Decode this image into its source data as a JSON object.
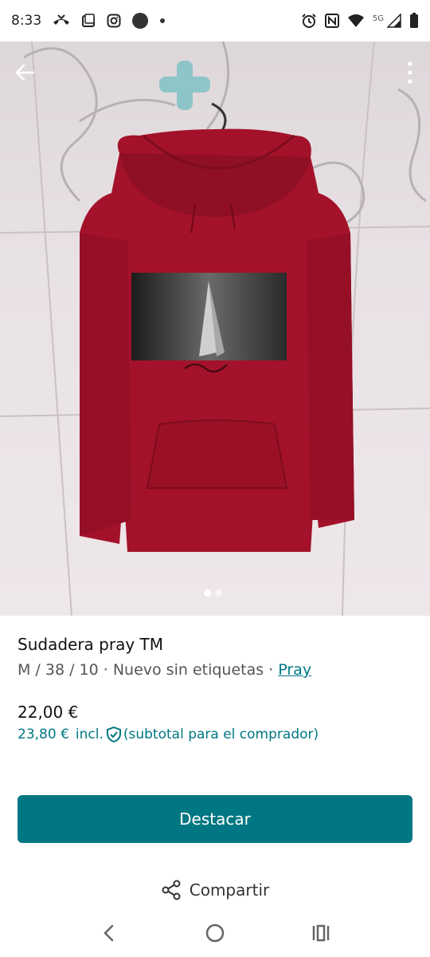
{
  "status_bar": {
    "time": "8:33",
    "network_label": "5G",
    "icons": [
      "missed-call-icon",
      "screenshot-icon",
      "instagram-icon",
      "circle-app-icon",
      "dot-icon",
      "alarm-icon",
      "nfc-icon",
      "wifi-icon",
      "signal-icon",
      "battery-icon"
    ]
  },
  "listing": {
    "title": "Sudadera pray TM",
    "details": "M / 38 / 10 · Nuevo sin etiquetas · ",
    "brand": "Pray",
    "price": "22,00 €",
    "buyer_price": "23,80 €",
    "buyer_price_suffix": "incl.",
    "buyer_price_note": "(subtotal para el comprador)",
    "photo_count": 2,
    "active_photo": 1
  },
  "actions": {
    "promote_label": "Destacar",
    "share_label": "Compartir"
  },
  "colors": {
    "accent": "#007782",
    "hoodie": "#a3122a"
  }
}
